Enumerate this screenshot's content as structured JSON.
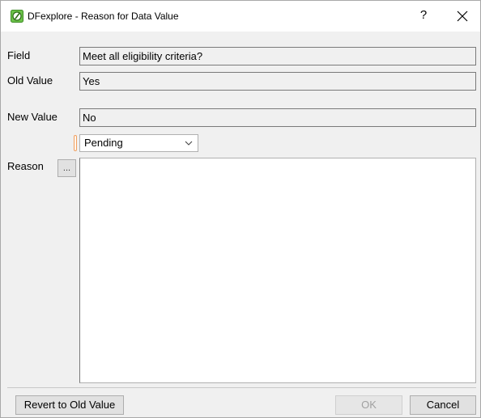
{
  "window": {
    "title": "DFexplore - Reason for Data Value",
    "help_glyph": "?",
    "app_icon": "dfexplore-logo-icon",
    "close_icon": "close-icon"
  },
  "form": {
    "field_label": "Field",
    "field_value": "Meet all eligibility criteria?",
    "old_value_label": "Old Value",
    "old_value": "Yes",
    "new_value_label": "New Value",
    "new_value": "No",
    "status_selected": "Pending",
    "reason_label": "Reason",
    "reason_button_label": "...",
    "reason_text": ""
  },
  "buttons": {
    "revert": "Revert to Old Value",
    "ok": "OK",
    "cancel": "Cancel"
  },
  "colors": {
    "icon_green": "#6cc24a",
    "status_marker": "#f0a060"
  }
}
